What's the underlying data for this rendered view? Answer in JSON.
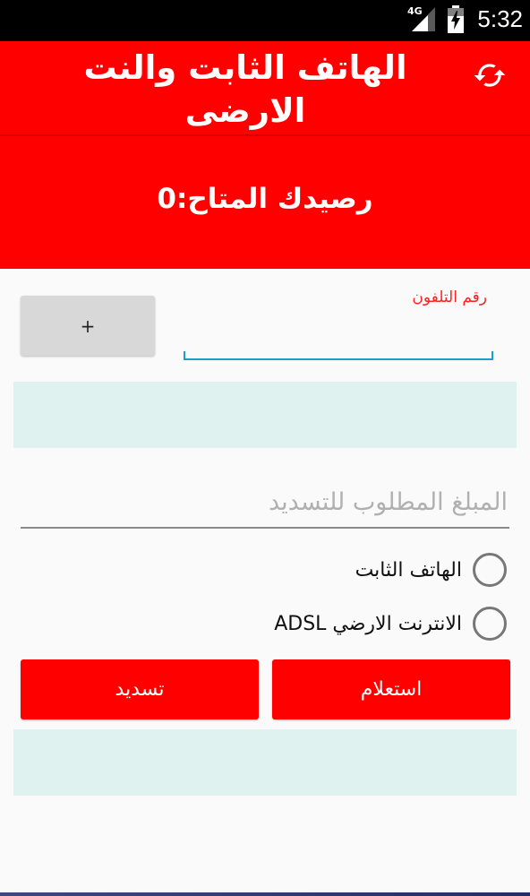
{
  "status_bar": {
    "time": "5:32",
    "network": "4G",
    "icons": [
      "signal-icon",
      "battery-charging-icon"
    ]
  },
  "app_bar": {
    "title": "الهاتف الثابت والنت الارضى",
    "refresh_icon": "refresh-icon"
  },
  "balance": {
    "text": "رصيدك المتاح:0"
  },
  "form": {
    "phone_label": "رقم التلفون",
    "phone_value": "",
    "plus_label": "+",
    "amount_placeholder": "المبلغ المطلوب للتسديد",
    "amount_value": "",
    "options": [
      {
        "label": "الهاتف الثابت",
        "selected": false
      },
      {
        "label": "الانترنت الارضي ADSL",
        "selected": false
      }
    ],
    "inquiry_label": "استعلام",
    "pay_label": "تسديد"
  },
  "colors": {
    "primary": "#ff0000",
    "info_box": "#dff2f0",
    "input_focus": "#1a9fc9",
    "label_red": "#ff2020"
  }
}
